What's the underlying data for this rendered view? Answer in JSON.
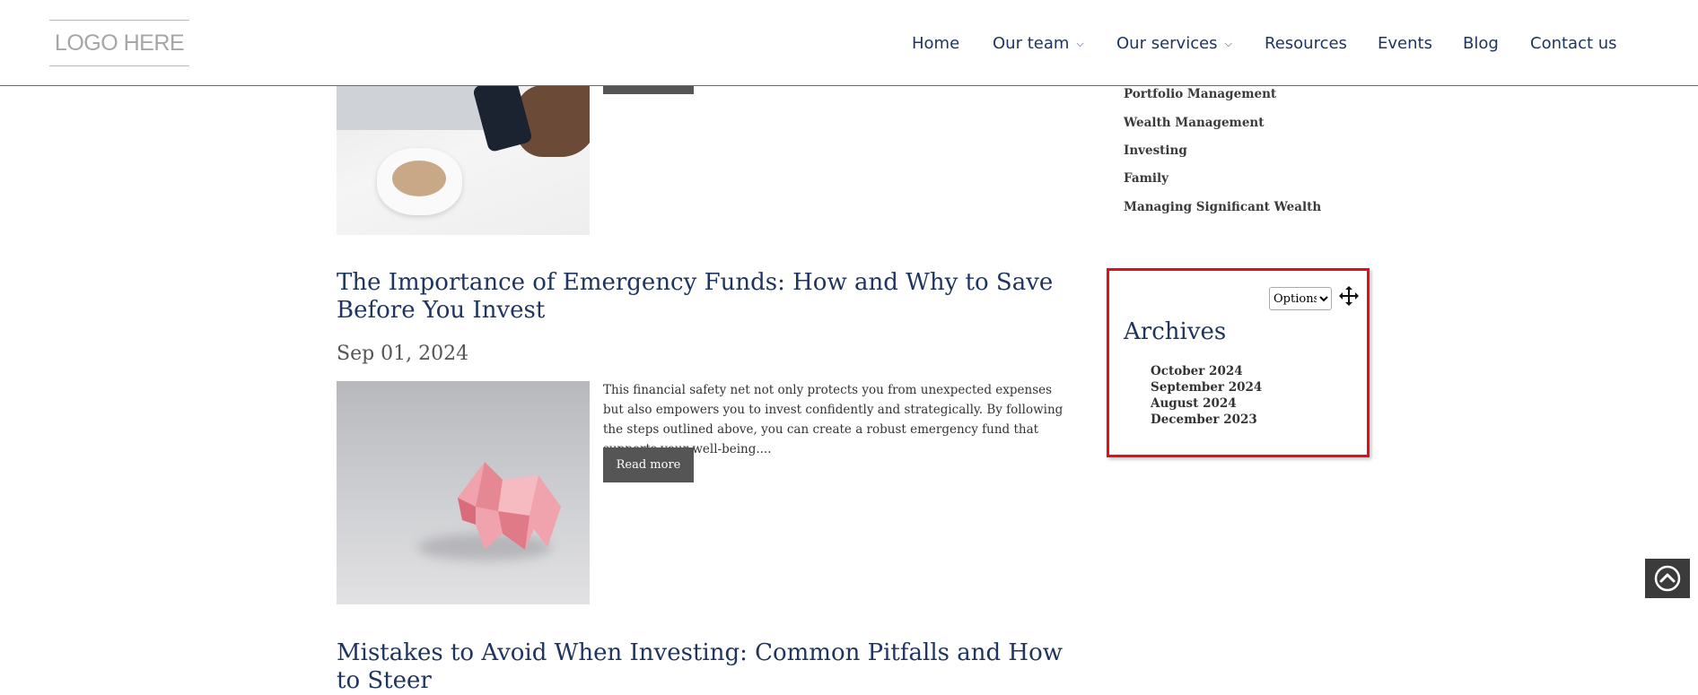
{
  "header": {
    "logo_text": "LOGO HERE",
    "nav": [
      {
        "label": "Home",
        "has_dropdown": false
      },
      {
        "label": "Our team",
        "has_dropdown": true
      },
      {
        "label": "Our services",
        "has_dropdown": true
      },
      {
        "label": "Resources",
        "has_dropdown": false
      },
      {
        "label": "Events",
        "has_dropdown": false
      },
      {
        "label": "Blog",
        "has_dropdown": false
      },
      {
        "label": "Contact us",
        "has_dropdown": false
      }
    ]
  },
  "posts": [
    {
      "title": "The Importance of Emergency Funds: How and Why to Save Before You Invest",
      "date": "Sep 01, 2024",
      "excerpt": "This financial safety net not only protects you from unexpected expenses but also empowers you to invest confidently and strategically. By following the steps outlined above, you can create a robust emergency fund that supports your well-being....",
      "read_more": "Read more"
    },
    {
      "title": "Mistakes to Avoid When Investing: Common Pitfalls and How to Steer"
    }
  ],
  "sidebar": {
    "categories": [
      "Portfolio Management",
      "Wealth Management",
      "Investing",
      "Family",
      "Managing Significant Wealth"
    ],
    "archives": {
      "options_label": "Options",
      "title": "Archives",
      "links": [
        "October 2024",
        "September 2024",
        "August 2024",
        "December 2023"
      ]
    }
  },
  "colors": {
    "title": "#1f3560",
    "button_bg": "#555555",
    "highlight_border": "#e0101a"
  },
  "icons": {
    "scroll_top": "chevron-up-circle-icon",
    "move": "move-arrows-icon"
  }
}
